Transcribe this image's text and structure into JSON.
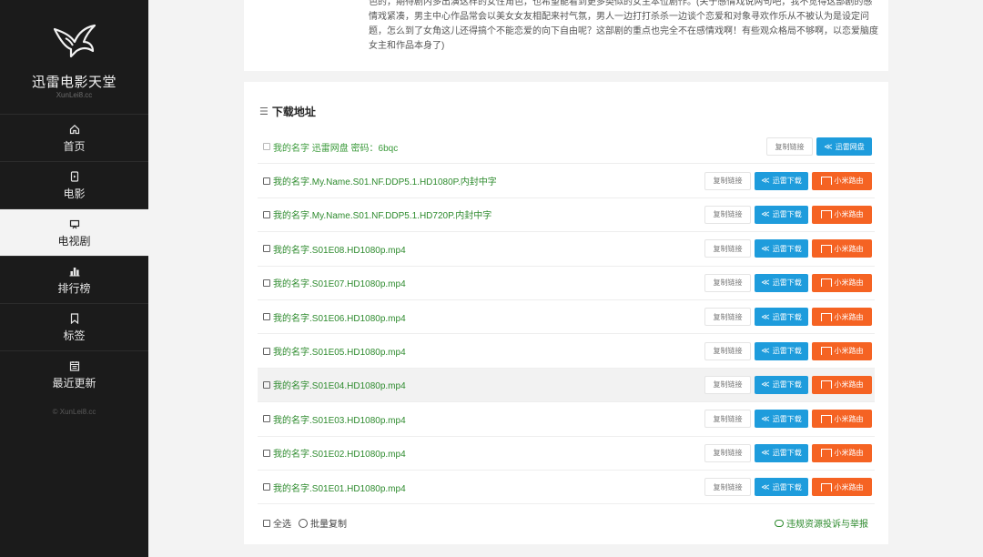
{
  "site": {
    "name": "迅雷电影天堂",
    "domain": "XunLei8.cc",
    "copyright": "© XunLei8.cc"
  },
  "nav": [
    {
      "label": "首页",
      "icon": "home-icon"
    },
    {
      "label": "电影",
      "icon": "film-icon"
    },
    {
      "label": "电视剧",
      "icon": "tv-icon",
      "active": true
    },
    {
      "label": "排行榜",
      "icon": "ranking-icon"
    },
    {
      "label": "标签",
      "icon": "bookmark-icon"
    },
    {
      "label": "最近更新",
      "icon": "calendar-icon"
    }
  ],
  "review_text": "色的，期待剧内多出演这样的女性角色，也希望能看到更多类似的女主本位剧作。(关于感情戏说两句吧，我不觉得这部剧的感情戏紧凑，男主中心作品常会以美女女友相配来衬气氛，男人一边打打杀杀一边谈个恋爱和对象寻欢作乐从不被认为是设定问题，怎么到了女角这儿还得搞个不能恋爱的向下自由呢？这部剧的重点也完全不在感情戏啊！有些观众格局不够啊，以恋爱脑度女主和作品本身了)",
  "downloads": {
    "title": "下载地址",
    "copy_label": "复制链接",
    "xunlei_label": "迅雷下载",
    "mi_label": "小米路由",
    "pan_label": "迅雷网盘",
    "pan_item": "我的名字 迅雷网盘 密码：6bqc",
    "items": [
      "我的名字.My.Name.S01.NF.DDP5.1.HD1080P.内封中字",
      "我的名字.My.Name.S01.NF.DDP5.1.HD720P.内封中字",
      "我的名字.S01E08.HD1080p.mp4",
      "我的名字.S01E07.HD1080p.mp4",
      "我的名字.S01E06.HD1080p.mp4",
      "我的名字.S01E05.HD1080p.mp4",
      "我的名字.S01E04.HD1080p.mp4",
      "我的名字.S01E03.HD1080p.mp4",
      "我的名字.S01E02.HD1080p.mp4",
      "我的名字.S01E01.HD1080p.mp4"
    ],
    "select_all": "全选",
    "batch_copy": "批量复制",
    "report": "违规资源投诉与举报"
  },
  "colors": {
    "sidebar": "#1b1b1b",
    "link_green": "#2e8b2e",
    "xunlei_blue": "#1e9cdc",
    "mi_orange": "#f56323"
  }
}
